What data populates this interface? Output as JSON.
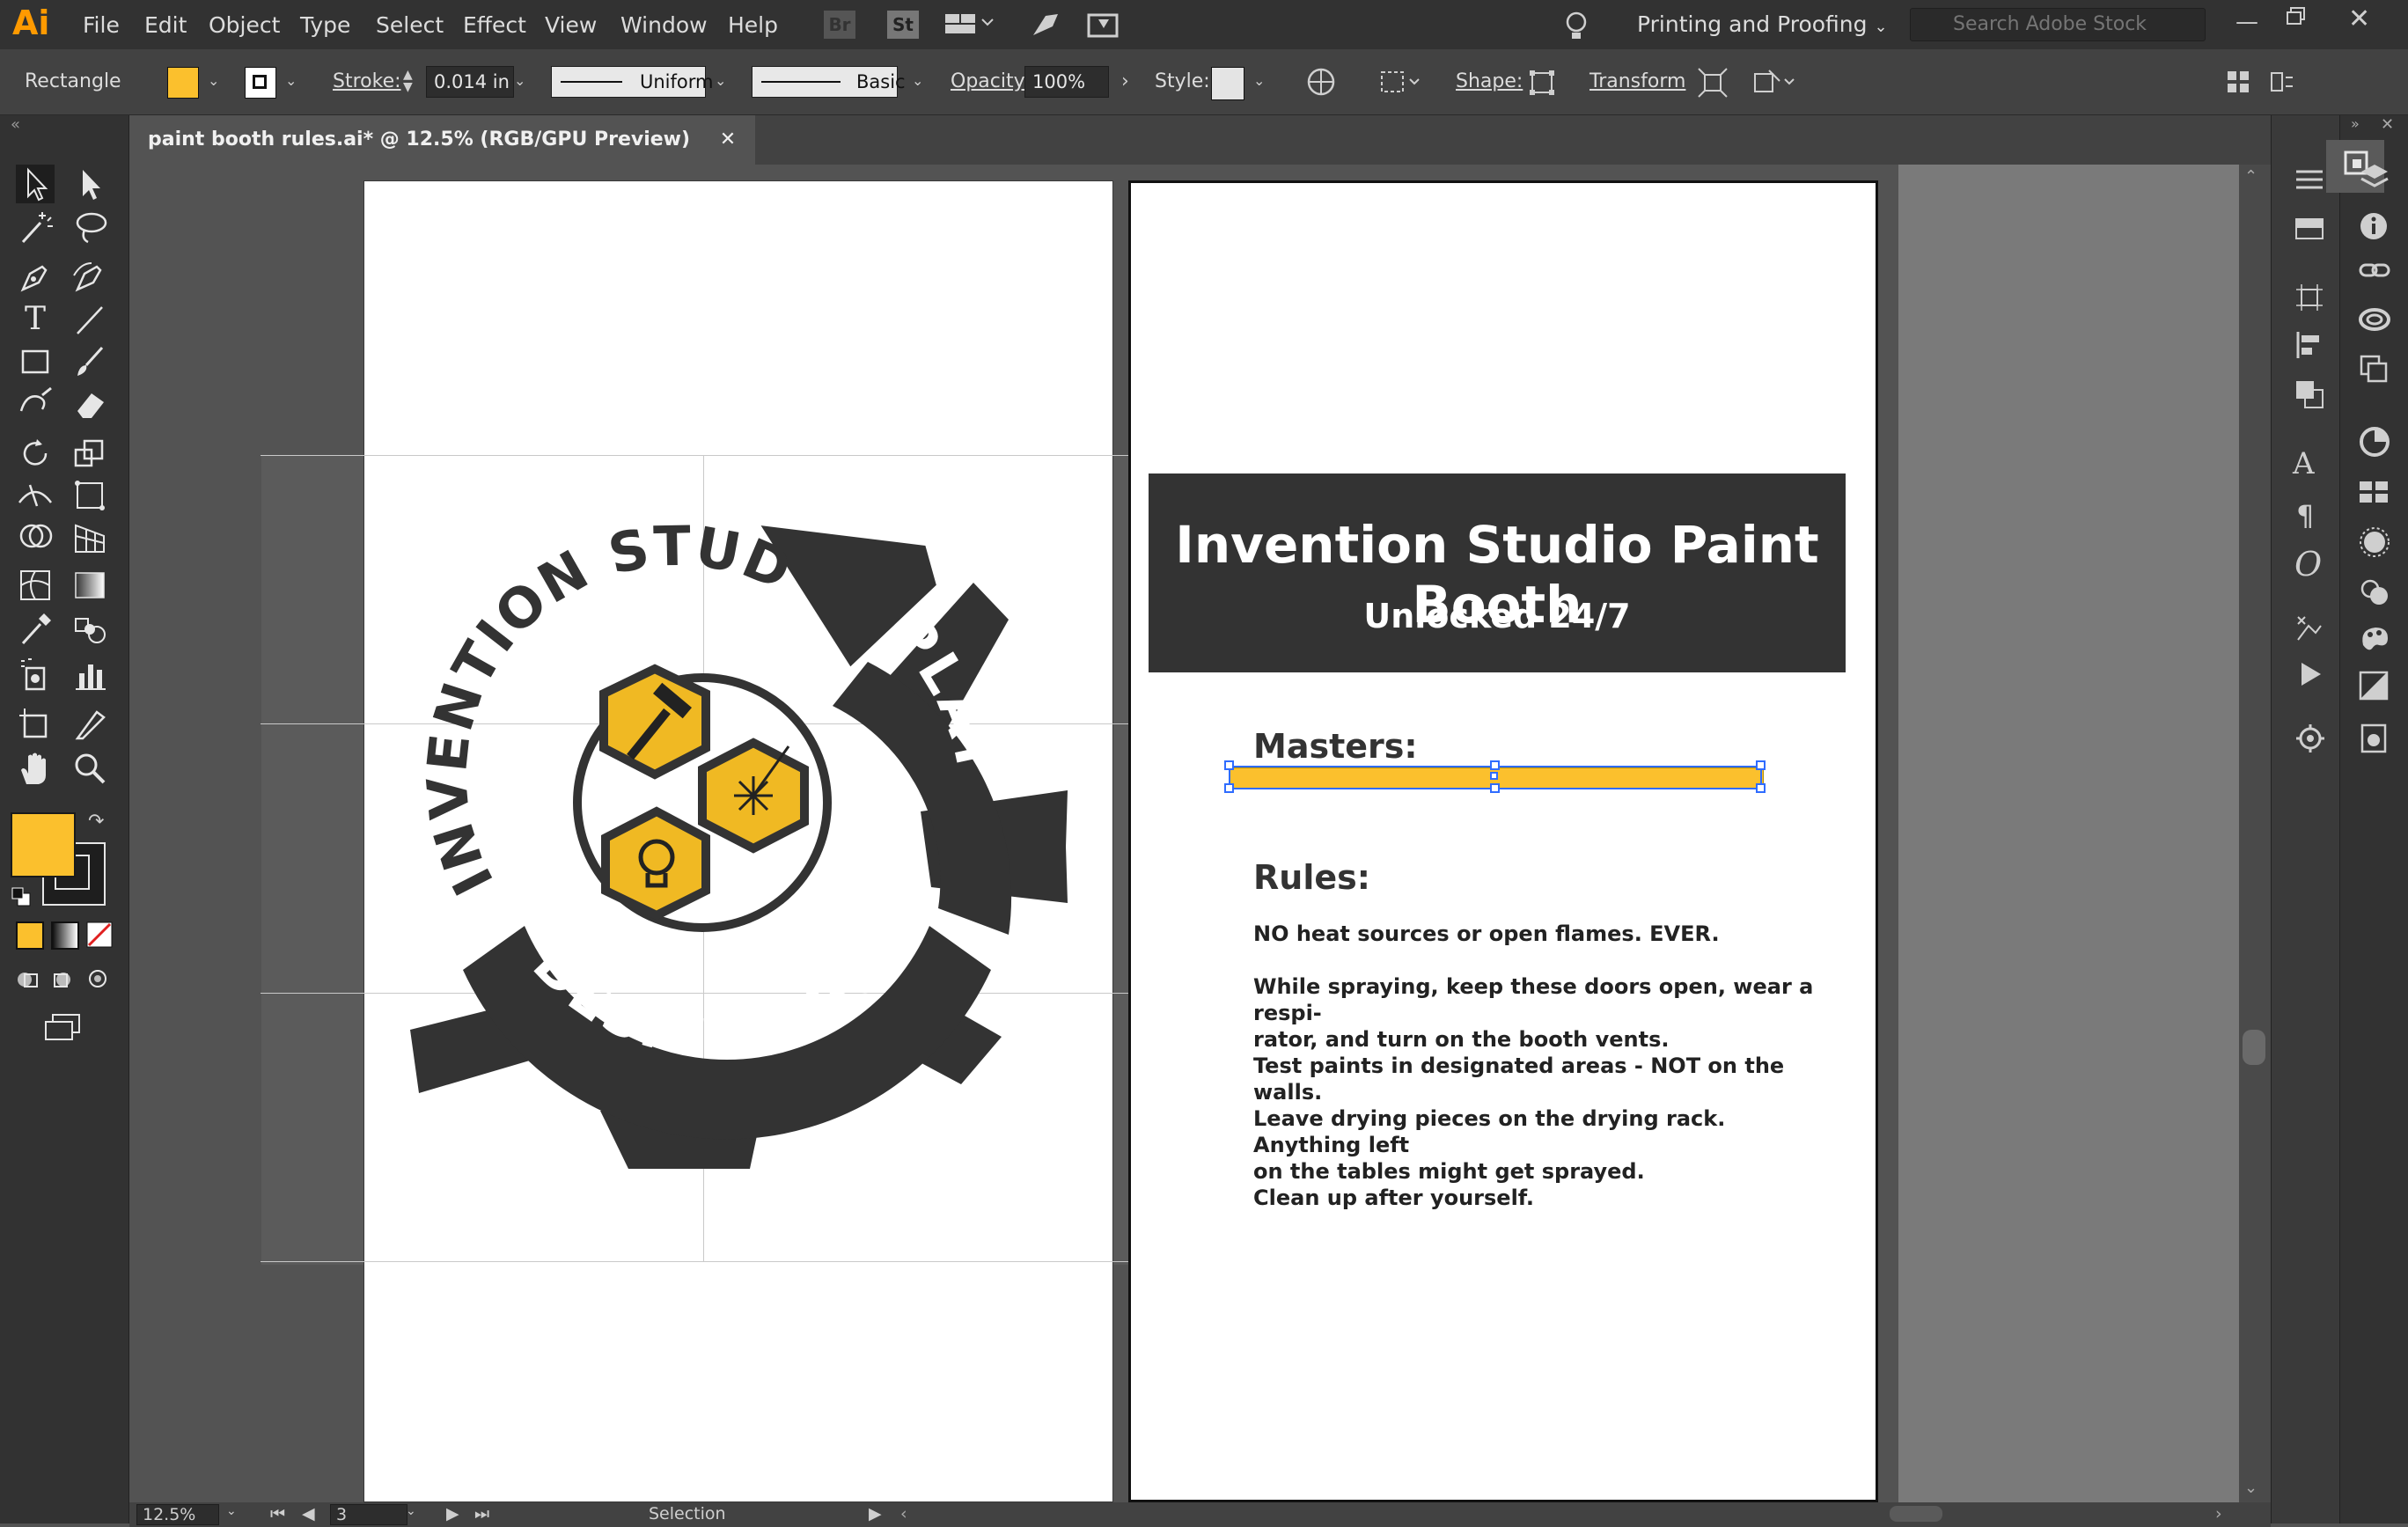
{
  "app": {
    "logo": "Ai"
  },
  "menu": [
    "File",
    "Edit",
    "Object",
    "Type",
    "Select",
    "Effect",
    "View",
    "Window",
    "Help"
  ],
  "toolbar_icons": {
    "bridge": "Br",
    "stock": "St"
  },
  "workspace": {
    "label": "Printing and Proofing"
  },
  "search": {
    "placeholder": "Search Adobe Stock"
  },
  "control": {
    "object_type": "Rectangle",
    "fill_color": "#fbc02d",
    "stroke_label": "Stroke:",
    "stroke_value": "0.014 in",
    "profile": "Uniform",
    "brush": "Basic",
    "opacity_label": "Opacity:",
    "opacity_value": "100%",
    "style_label": "Style:",
    "shape_label": "Shape:",
    "transform_label": "Transform"
  },
  "document": {
    "tab_title": "paint booth rules.ai* @ 12.5% (RGB/GPU Preview)",
    "close": "✕"
  },
  "logo_art": {
    "top_text": "INVENTION STUDIO",
    "right_text": "PLAY",
    "bottom_text": "DESIGN - BUILD -",
    "dark_color": "#333333",
    "accent_color": "#f0b923"
  },
  "flyer": {
    "title": "Invention Studio Paint Booth",
    "subtitle": "Unlocked 24/7",
    "masters_label": "Masters:",
    "rules_label": "Rules:",
    "rules": [
      "NO heat sources or open flames. EVER.",
      "While spraying, keep these doors open, wear a respi-\nrator, and turn on the booth vents.",
      "Test paints in designated areas - NOT on the walls.",
      "Leave drying pieces on the drying rack. Anything left\non the tables might get sprayed.",
      "Clean up after yourself."
    ],
    "bar_color": "#fbc02d"
  },
  "status": {
    "zoom": "12.5%",
    "artboard": "3",
    "mode": "Selection"
  }
}
